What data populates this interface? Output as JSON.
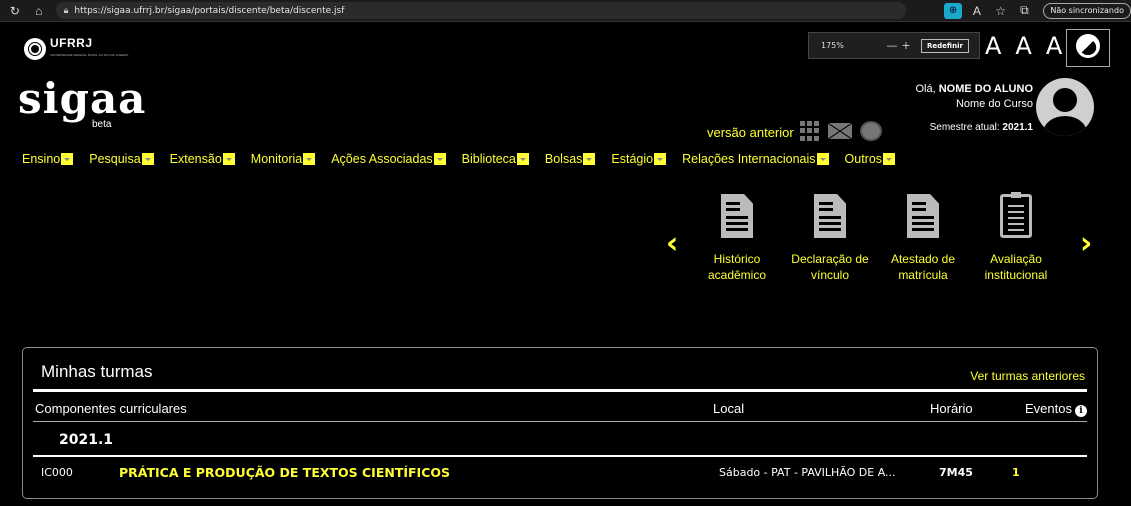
{
  "browser": {
    "url": "https://sigaa.ufrrj.br/sigaa/portais/discente/beta/discente.jsf",
    "sync_label": "Não sincronizando",
    "zoom": {
      "percent": "175%",
      "minus": "—",
      "plus": "+",
      "reset_label": "Redefinir"
    }
  },
  "header": {
    "institution": "UFRRJ",
    "institution_sub": "UNIVERSIDADE FEDERAL RURAL DO RIO DE JANEIRO",
    "app_name": "sigaa",
    "app_badge": "beta",
    "previous_version": "versão anterior",
    "font_tools": [
      "A",
      "A",
      "A"
    ],
    "user": {
      "greeting": "Olá, ",
      "name": "NOME DO ALUNO",
      "course": "Nome do Curso",
      "semester_label": "Semestre atual: ",
      "semester": "2021.1"
    }
  },
  "menu": {
    "items": [
      {
        "label": "Ensino"
      },
      {
        "label": "Pesquisa"
      },
      {
        "label": "Extensão"
      },
      {
        "label": "Monitoria"
      },
      {
        "label": "Ações Associadas"
      },
      {
        "label": "Biblioteca"
      },
      {
        "label": "Bolsas"
      },
      {
        "label": "Estágio"
      },
      {
        "label": "Relações Internacionais"
      },
      {
        "label": "Outros"
      }
    ]
  },
  "shortcuts": {
    "items": [
      {
        "line1": "Histórico",
        "line2": "acadêmico",
        "icon": "document-icon"
      },
      {
        "line1": "Declaração de",
        "line2": "vínculo",
        "icon": "document-icon"
      },
      {
        "line1": "Atestado de",
        "line2": "matrícula",
        "icon": "document-icon"
      },
      {
        "line1": "Avaliação",
        "line2": "institucional",
        "icon": "clipboard-icon"
      }
    ]
  },
  "turmas": {
    "title": "Minhas turmas",
    "previous_link": "Ver turmas anteriores",
    "columns": {
      "component": "Componentes curriculares",
      "local": "Local",
      "schedule": "Horário",
      "events": "Eventos"
    },
    "year": "2021.1",
    "rows": [
      {
        "code": "IC000",
        "name": "PRÁTICA E PRODUÇÃO DE TEXTOS CIENTÍFICOS",
        "local": "Sábado - PAT - PAVILHÃO DE A...",
        "schedule": "7M45",
        "events": "1"
      }
    ]
  },
  "colors": {
    "accent": "#ffff33",
    "background": "#000000",
    "text": "#ffffff"
  }
}
